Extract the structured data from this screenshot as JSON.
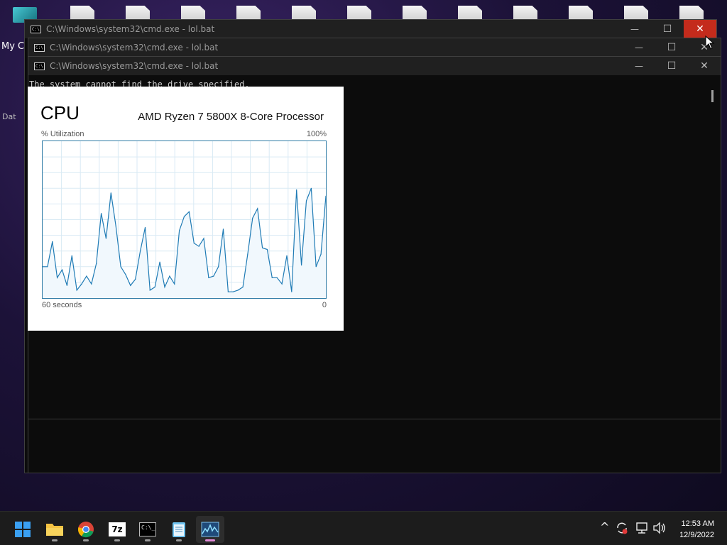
{
  "desktop": {
    "label_partial": "My C",
    "label_partial2": "Dat"
  },
  "windows": [
    {
      "title": "C:\\Windows\\system32\\cmd.exe - lol.bat",
      "minimize": "—",
      "maximize": "☐",
      "close": "✕"
    },
    {
      "title": "C:\\Windows\\system32\\cmd.exe - lol.bat",
      "minimize": "—",
      "maximize": "☐",
      "close": "✕"
    },
    {
      "title": "C:\\Windows\\system32\\cmd.exe - lol.bat",
      "minimize": "—",
      "maximize": "☐",
      "close": "✕"
    }
  ],
  "console": {
    "output": "The system cannot find the drive specified."
  },
  "cpu_panel": {
    "title": "CPU",
    "processor": "AMD Ryzen 7 5800X 8-Core Processor",
    "y_label": "% Utilization",
    "y_max_label": "100%",
    "x_left_label": "60 seconds",
    "x_right_label": "0"
  },
  "chart_data": {
    "type": "area",
    "title": "CPU",
    "ylabel": "% Utilization",
    "xlabel": "60 seconds",
    "ylim": [
      0,
      100
    ],
    "xlim": [
      60,
      0
    ],
    "grid": true,
    "series": [
      {
        "values": [
          20,
          20,
          36,
          13,
          18,
          8,
          27,
          5,
          9,
          14,
          9,
          22,
          54,
          38,
          67,
          46,
          20,
          15,
          8,
          12,
          30,
          45,
          5,
          7,
          23,
          7,
          14,
          9,
          43,
          52,
          55,
          35,
          33,
          38,
          13,
          14,
          20,
          44,
          4,
          4,
          5,
          7,
          28,
          51,
          57,
          32,
          31,
          13,
          13,
          9,
          27,
          4,
          69,
          21,
          62,
          70,
          20,
          28,
          65
        ]
      }
    ]
  },
  "taskbar": {
    "apps": [
      {
        "name": "Start"
      },
      {
        "name": "File Explorer"
      },
      {
        "name": "Google Chrome"
      },
      {
        "name": "7-Zip",
        "glyph": "7z"
      },
      {
        "name": "Command Prompt",
        "glyph": "C:\\_"
      },
      {
        "name": "Notepad"
      },
      {
        "name": "Task Manager"
      }
    ],
    "tray_chevron": "^",
    "clock_time": "12:53 AM",
    "clock_date": "12/9/2022"
  }
}
